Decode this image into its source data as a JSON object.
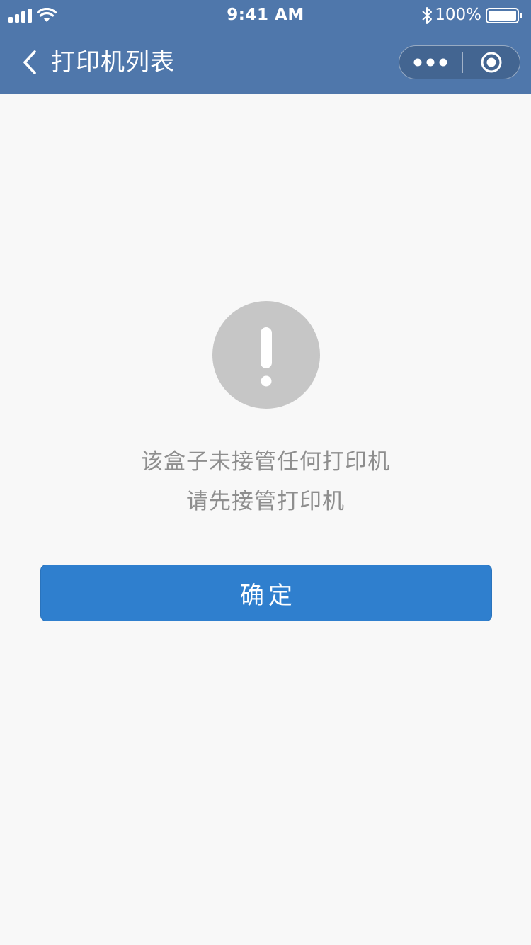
{
  "status_bar": {
    "time": "9:41 AM",
    "battery": "100%",
    "icons": [
      "signal-icon",
      "wifi-icon",
      "bluetooth-icon",
      "battery-icon"
    ]
  },
  "nav": {
    "title": "打印机列表",
    "icons": [
      "chevron-left-icon",
      "more-dots-icon",
      "close-target-icon"
    ]
  },
  "main": {
    "icon": "exclamation-icon",
    "message_line1": "该盒子未接管任何打印机",
    "message_line2": "请先接管打印机",
    "confirm_label": "确定"
  },
  "colors": {
    "header_bg": "#4f77ab",
    "page_bg": "#f8f8f8",
    "button_bg": "#2f7fce",
    "icon_circle": "#c6c6c6",
    "message_text": "#8e8e8e"
  }
}
